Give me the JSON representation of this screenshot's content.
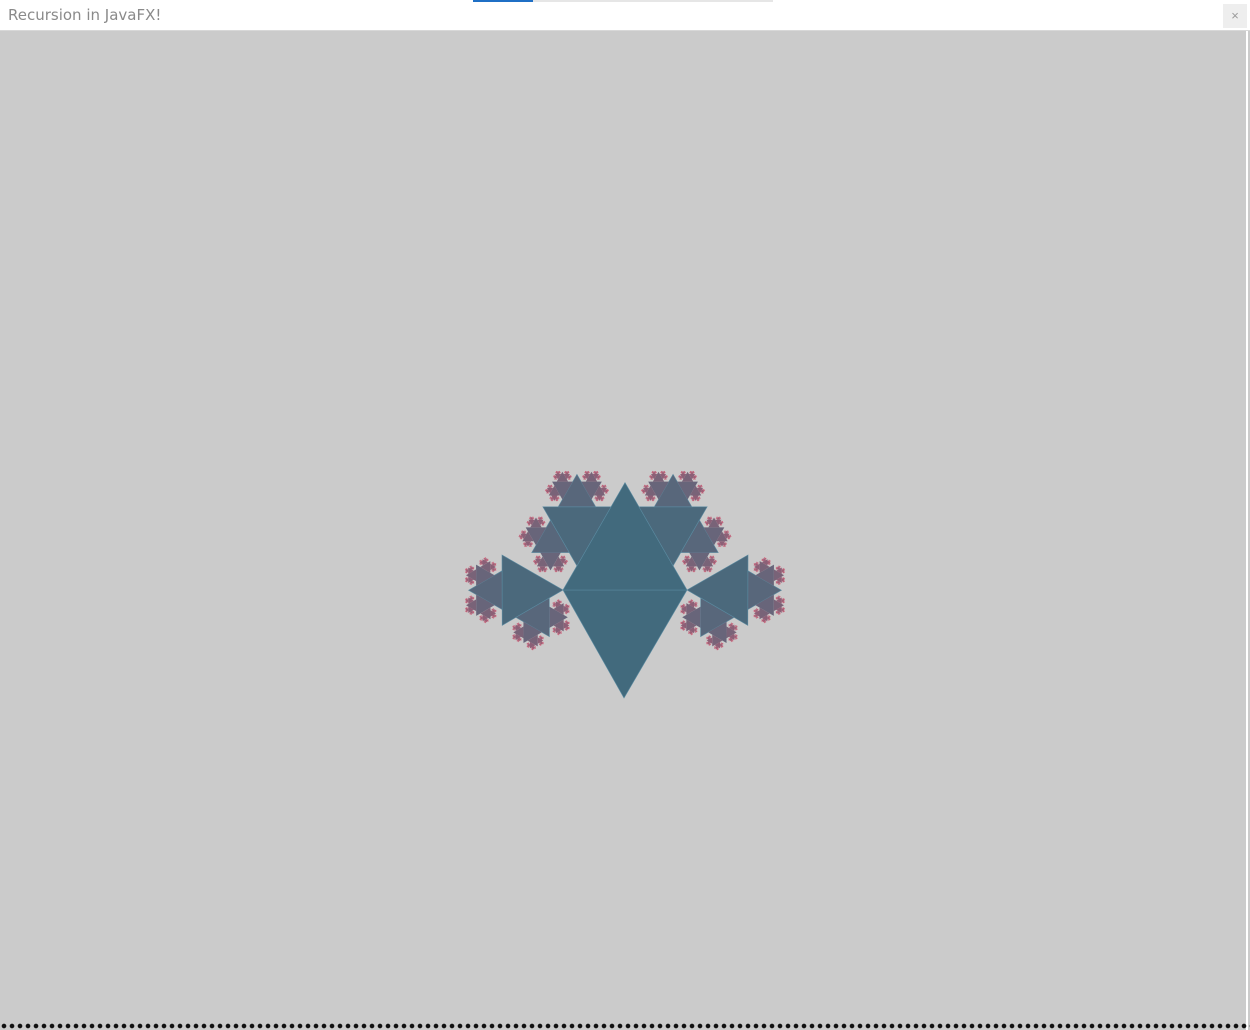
{
  "window": {
    "title": "Recursion in JavaFX!",
    "close_symbol": "×"
  },
  "icons": {
    "close": "close-icon"
  },
  "fractal": {
    "description_name": "pythagoras-tree-triangle-fractal",
    "depth": 9,
    "background_color": "#cbcbcb",
    "trunk_color": "#426a7d",
    "leaf_color": "#e05570",
    "edge_color": "#5a8aa0"
  }
}
